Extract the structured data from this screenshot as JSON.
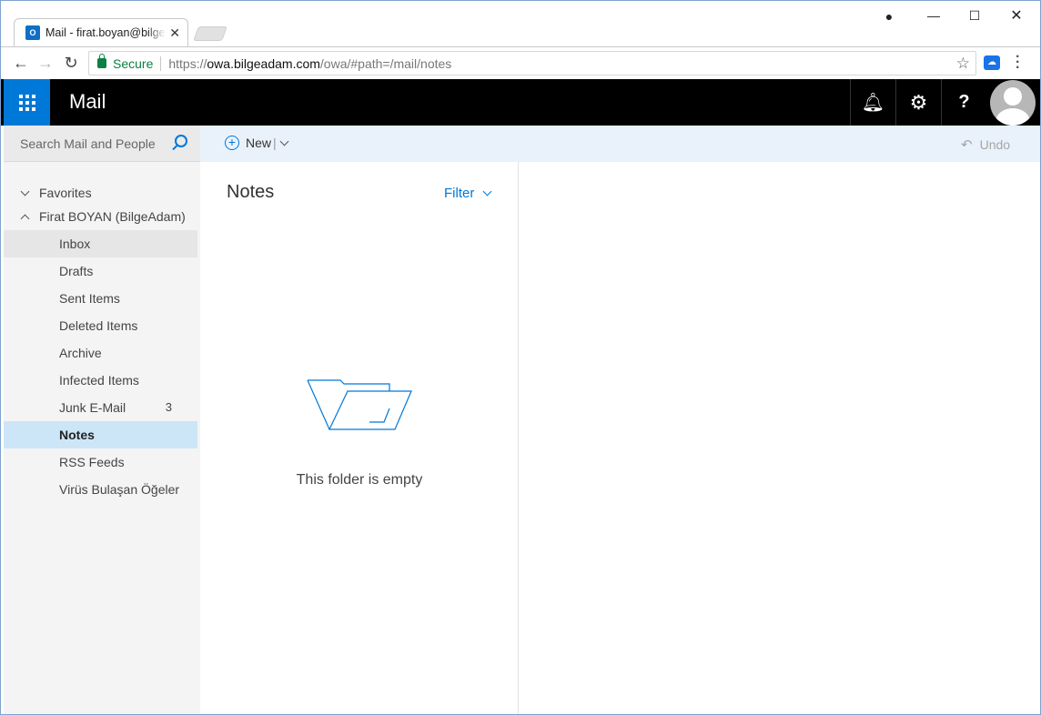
{
  "browser": {
    "tab_title": "Mail - firat.boyan@bilgeadam.com",
    "secure_label": "Secure",
    "url_scheme": "https://",
    "url_host": "owa.bilgeadam.com",
    "url_path": "/owa/#path=/mail/notes"
  },
  "header": {
    "app_title": "Mail",
    "brand_color": "#0078d7"
  },
  "search": {
    "placeholder": "Search Mail and People"
  },
  "commands": {
    "new_label": "New",
    "undo_label": "Undo"
  },
  "folders": {
    "favorites_label": "Favorites",
    "account_label": "Firat BOYAN (BilgeAdam)",
    "items": [
      {
        "label": "Inbox",
        "count": ""
      },
      {
        "label": "Drafts",
        "count": ""
      },
      {
        "label": "Sent Items",
        "count": ""
      },
      {
        "label": "Deleted Items",
        "count": ""
      },
      {
        "label": "Archive",
        "count": ""
      },
      {
        "label": "Infected Items",
        "count": ""
      },
      {
        "label": "Junk E-Mail",
        "count": "3"
      },
      {
        "label": "Notes",
        "count": ""
      },
      {
        "label": "RSS Feeds",
        "count": ""
      },
      {
        "label": "Virüs Bulaşan Öğeler",
        "count": ""
      }
    ],
    "selected": "Notes"
  },
  "list": {
    "title": "Notes",
    "filter_label": "Filter",
    "empty_message": "This folder is empty"
  }
}
